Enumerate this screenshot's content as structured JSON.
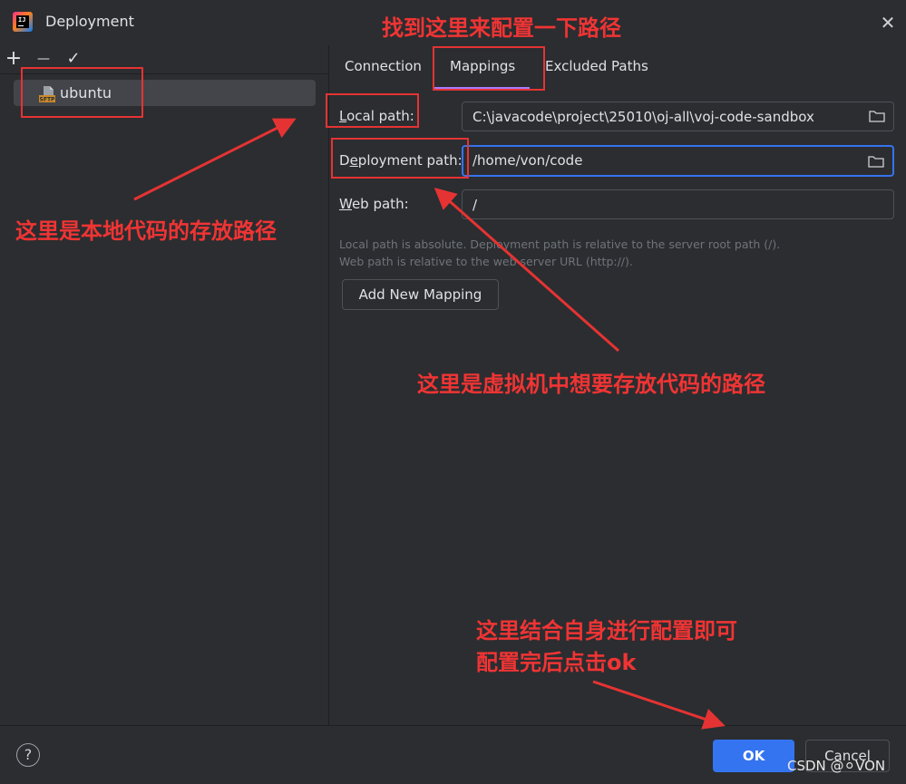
{
  "window": {
    "title": "Deployment",
    "close_glyph": "✕"
  },
  "toolbar": {
    "add_glyph": "+",
    "remove_glyph": "—",
    "apply_glyph": "✓"
  },
  "servers": [
    {
      "label": "ubuntu",
      "icon": "sftp-icon",
      "icon_text": "SFTP"
    }
  ],
  "tabs": [
    {
      "label": "Connection",
      "selected": false
    },
    {
      "label": "Mappings",
      "selected": true
    },
    {
      "label": "Excluded Paths",
      "selected": false
    }
  ],
  "mapping": {
    "local_label_mn": "L",
    "local_label_rest": "ocal path:",
    "local_value": "C:\\javacode\\project\\25010\\oj-all\\voj-code-sandbox",
    "deploy_label_pre": "D",
    "deploy_label_mn": "e",
    "deploy_label_rest": "ployment path:",
    "deploy_value": "/home/von/code",
    "web_label_mn": "W",
    "web_label_rest": "eb path:",
    "web_value": "/",
    "hint_1": "Local path is absolute. Deployment path is relative to the server root path (/).",
    "hint_2": "Web path is relative to the web server URL (http://).",
    "add_button": "Add New Mapping"
  },
  "footer": {
    "help_glyph": "?",
    "ok": "OK",
    "cancel": "Cancel",
    "watermark": "CSDN @⚪VON"
  },
  "annotations": {
    "top": "找到这里来配置一下路径",
    "local": "这里是本地代码的存放路径",
    "deploy": "这里是虚拟机中想要存放代码的路径",
    "bottom_1": "这里结合自身进行配置即可",
    "bottom_2": "配置完后点击ok",
    "color": "#e53333"
  },
  "colors": {
    "background": "#2b2d30",
    "accent": "#3574f0",
    "tab_underline": "#a97bff"
  }
}
